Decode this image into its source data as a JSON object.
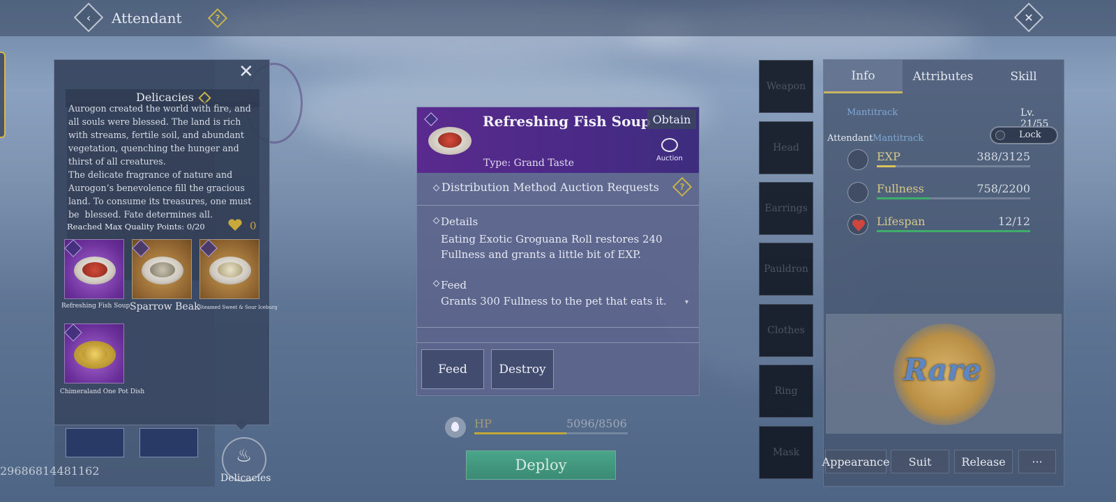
{
  "topbar": {
    "title": "Attendant"
  },
  "delicacies": {
    "title": "Delicacies",
    "lore": "Aurogon created the world with fire, and all souls were blessed. The land is rich with streams, fertile soil, and abundant vegetation, quenching the hunger and thirst of all creatures.\nThe delicate fragrance of nature and Aurogon’s benevolence fill the gracious land. To consume its treasures, one must be  blessed. Fate determines all.",
    "quality_text": "Reached Max Quality Points: 0/20",
    "quality_count": "0",
    "foods": [
      {
        "name": "Refreshing Fish Soup"
      },
      {
        "name": "Sparrow Beak"
      },
      {
        "name": "Steamed Sweet & Sour Iceburg"
      },
      {
        "name": "Chimeraland One Pot Dish"
      }
    ]
  },
  "bottom_left": {
    "player_id": "29686814481162",
    "delicacies_button": "Delicacies"
  },
  "item": {
    "name": "Refreshing Fish Soup",
    "obtain_button": "Obtain",
    "type": "Type: Grand Taste",
    "auction_label": "Auction",
    "distribution_label": "Distribution Method",
    "distribution_value": "Auction Requests",
    "details_title": "Details",
    "details_text": "Eating Exotic Groguana Roll restores 240 Fullness and grants a little bit of EXP.",
    "feed_title": "Feed",
    "feed_text": "Grants 300 Fullness to the pet that eats it.",
    "feed_button": "Feed",
    "destroy_button": "Destroy"
  },
  "hp": {
    "label": "HP",
    "value": "5096/8506",
    "fraction": 0.599
  },
  "deploy_button": "Deploy",
  "equipment": [
    "Weapon",
    "Head",
    "Earrings",
    "Pauldron",
    "Clothes",
    "Ring",
    "Mask"
  ],
  "info_panel": {
    "tabs": [
      "Info",
      "Attributes",
      "Skill"
    ],
    "pet_name": "Mantitrack",
    "level": "Lv. 21/55",
    "attendant_label": "Attendant",
    "attendant_name": "Mantitrack",
    "lock_label": "Lock",
    "stats": [
      {
        "label": "EXP",
        "value": "388/3125",
        "fraction": 0.124,
        "color": "#d7c35a"
      },
      {
        "label": "Fullness",
        "value": "758/2200",
        "fraction": 0.345,
        "color": "#3fae6a"
      },
      {
        "label": "Lifespan",
        "value": "12/12",
        "fraction": 1.0,
        "color": "#3fae6a"
      }
    ],
    "rarity": "Rare",
    "buttons": [
      "Appearance",
      "Suit",
      "Release",
      "···"
    ]
  },
  "colors": {
    "item_header": "#5a2a8e",
    "deploy": "#3f9a7e",
    "gold_text": "#d8c98a",
    "link_blue": "#7fa8d8"
  }
}
